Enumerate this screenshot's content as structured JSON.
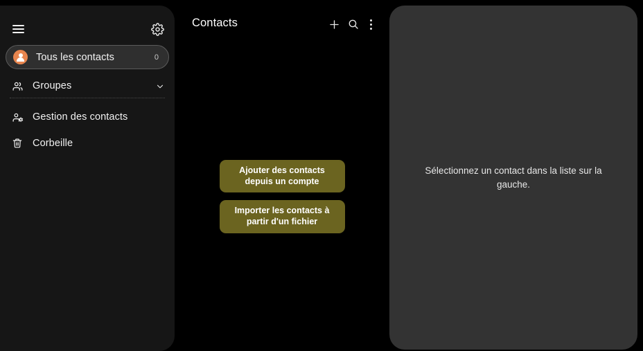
{
  "app": {
    "title": "Contacts"
  },
  "sidebar": {
    "menu_icon": "hamburger-icon",
    "settings_icon": "gear-icon",
    "all_contacts": {
      "label": "Tous les contacts",
      "count": "0",
      "icon": "contact-avatar-icon",
      "accent_color": "#e8854e"
    },
    "items": [
      {
        "label": "Groupes",
        "icon": "group-icon",
        "trailing_icon": "chevron-down-icon"
      },
      {
        "label": "Gestion des contacts",
        "icon": "manage-contacts-icon"
      },
      {
        "label": "Corbeille",
        "icon": "trash-icon"
      }
    ]
  },
  "header": {
    "title": "Contacts",
    "actions": [
      {
        "name": "add",
        "icon": "plus-icon"
      },
      {
        "name": "search",
        "icon": "search-icon"
      },
      {
        "name": "more",
        "icon": "more-vertical-icon"
      }
    ]
  },
  "main": {
    "buttons": [
      {
        "label": "Ajouter des contacts depuis un compte"
      },
      {
        "label": "Importer les contacts à partir d'un fichier"
      }
    ],
    "button_color": "#6b6420"
  },
  "detail": {
    "empty_message": "Sélectionnez un contact dans la liste sur la gauche."
  },
  "colors": {
    "page_background": "#000000",
    "sidebar_background": "#161616",
    "detail_background": "#333333",
    "accent": "#e8854e",
    "button": "#6b6420"
  }
}
